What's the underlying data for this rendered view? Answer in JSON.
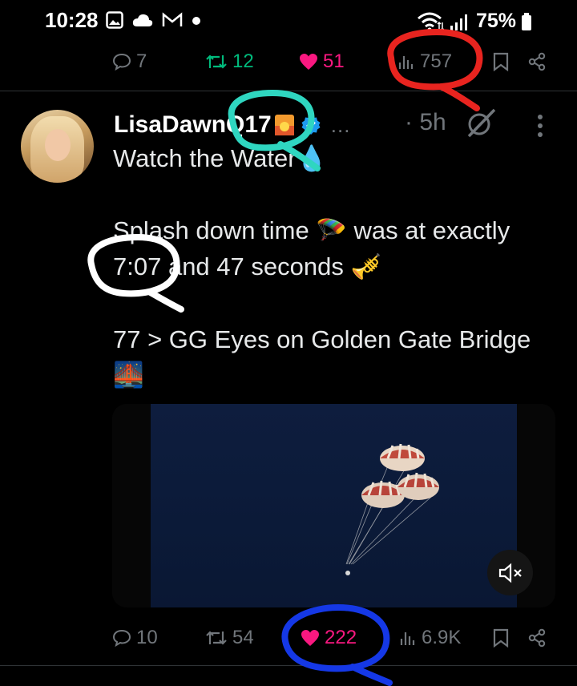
{
  "status_bar": {
    "time": "10:28",
    "battery": "75%",
    "left_icons": [
      "image-icon",
      "cloud-icon",
      "gmail-icon",
      "dot-icon"
    ],
    "right_icons": [
      "wifi-icon",
      "signal-icon",
      "battery-icon"
    ]
  },
  "prev_tweet_actions": {
    "replies": "7",
    "reposts": "12",
    "likes": "51",
    "views": "757"
  },
  "tweet": {
    "username": "LisaDawnQ17",
    "time": "· 5h",
    "ellipsis": "...",
    "line1": "Watch the Water💧",
    "line2": "Splash down time 🪂 was at exactly",
    "line3": "7:07 and 47 seconds 🎺",
    "line4": "77 > GG  Eyes on Golden Gate Bridge",
    "line5": "🌉",
    "actions": {
      "replies": "10",
      "reposts": "54",
      "likes": "222",
      "views": "6.9K"
    }
  },
  "colors": {
    "background": "#000000",
    "text": "#e7e9ea",
    "muted": "#71767b",
    "repost_green": "#00ba7c",
    "like_pink": "#f91880",
    "verified_blue": "#1d9bf0",
    "annotation_red": "#e8241f",
    "annotation_teal": "#2fd6c0",
    "annotation_white": "#ffffff",
    "annotation_blue": "#1538e6"
  }
}
